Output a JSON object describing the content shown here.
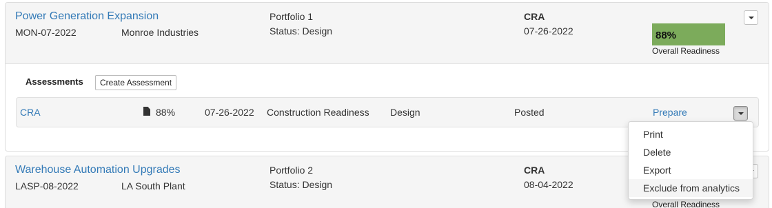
{
  "projects": [
    {
      "title": "Power Generation Expansion",
      "code": "MON-07-2022",
      "company": "Monroe Industries",
      "portfolio": "Portfolio 1",
      "status": "Status: Design",
      "assessment_type": "CRA",
      "date": "07-26-2022",
      "readiness_value": "88%",
      "readiness_label": "Overall Readiness",
      "readiness_fraction": 0.88,
      "readiness_color": "#7cab5b",
      "assessments_label": "Assessments",
      "create_assessment_label": "Create Assessment",
      "assessments": [
        {
          "name": "CRA",
          "score": "88%",
          "date": "07-26-2022",
          "kind": "Construction Readiness",
          "phase": "Design",
          "status": "Posted",
          "action": "Prepare"
        }
      ]
    },
    {
      "title": "Warehouse Automation Upgrades",
      "code": "LASP-08-2022",
      "company": "LA South Plant",
      "portfolio": "Portfolio 2",
      "status": "Status: Design",
      "assessment_type": "CRA",
      "date": "08-04-2022",
      "readiness_label": "Overall Readiness"
    }
  ],
  "dropdown_menu": {
    "items": [
      "Print",
      "Delete",
      "Export",
      "Exclude from analytics"
    ],
    "hovered_item": "Exclude from analytics"
  },
  "icons": {
    "caret": "chevron-down-icon",
    "file": "file-icon"
  },
  "colors": {
    "link": "#337ab7",
    "readiness_good": "#7cab5b",
    "panel_header": "#f5f5f5"
  }
}
